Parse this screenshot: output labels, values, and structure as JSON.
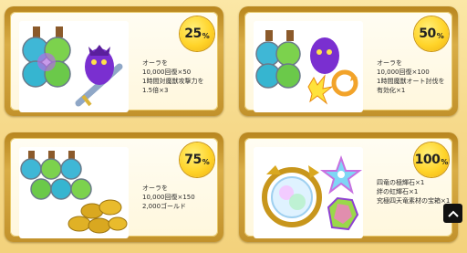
{
  "rewards": [
    {
      "percent": "25",
      "lines": [
        "オーラを",
        "10,000回復×50",
        "1時間対魔獣攻撃力を",
        "1.5倍×3"
      ]
    },
    {
      "percent": "50",
      "lines": [
        "オーラを",
        "10,000回復×100",
        "1時間魔獣オート討伐を",
        "有効化×1"
      ]
    },
    {
      "percent": "75",
      "lines": [
        "オーラを",
        "10,000回復×150",
        "2,000ゴールド"
      ]
    },
    {
      "percent": "100",
      "lines": [
        "四竜の極輝石×1",
        "絆の虹輝石×1",
        "究極四天竜素材の宝箱×1"
      ]
    }
  ],
  "percent_sign": "%",
  "icons": {
    "scroll_top": "chevron-up-icon",
    "aura_potions": "potion-bottles-icon",
    "monster_attack": "purple-monster-sword-icon",
    "monster_auto": "purple-monster-auto-icon",
    "gold": "gold-coins-icon",
    "dragon_gem": "golden-dragon-orb-icon",
    "rainbow_star": "rainbow-star-icon"
  },
  "colors": {
    "badge": "#ffd42a",
    "frame": "#c99a35",
    "background": "#f6d98a"
  }
}
